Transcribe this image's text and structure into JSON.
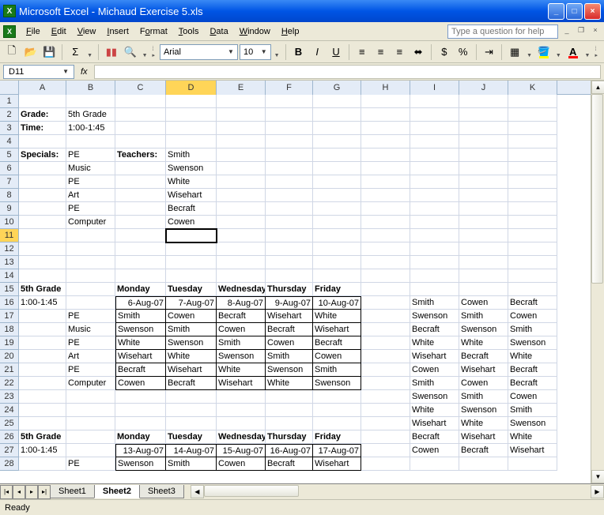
{
  "titlebar": {
    "app": "Microsoft Excel",
    "doc": "Michaud Exercise 5.xls"
  },
  "menu": {
    "file": "File",
    "edit": "Edit",
    "view": "View",
    "insert": "Insert",
    "format": "Format",
    "tools": "Tools",
    "data": "Data",
    "window": "Window",
    "help": "Help",
    "helpbox": "Type a question for help"
  },
  "toolbar": {
    "font": "Arial",
    "size": "10"
  },
  "namebox": {
    "ref": "D11",
    "fx": "fx"
  },
  "columns": [
    "A",
    "B",
    "C",
    "D",
    "E",
    "F",
    "G",
    "H",
    "I",
    "J",
    "K"
  ],
  "rows": [
    "1",
    "2",
    "3",
    "4",
    "5",
    "6",
    "7",
    "8",
    "9",
    "10",
    "11",
    "12",
    "13",
    "14",
    "15",
    "16",
    "17",
    "18",
    "19",
    "20",
    "21",
    "22",
    "23",
    "24",
    "25",
    "26",
    "27",
    "28"
  ],
  "cells": {
    "r2": {
      "A": "Grade:",
      "B": "5th Grade"
    },
    "r3": {
      "A": "Time:",
      "B": "1:00-1:45"
    },
    "r5": {
      "A": "Specials:",
      "B": "PE",
      "C": "Teachers:",
      "D": "Smith"
    },
    "r6": {
      "B": "Music",
      "D": "Swenson"
    },
    "r7": {
      "B": "PE",
      "D": "White"
    },
    "r8": {
      "B": "Art",
      "D": "Wisehart"
    },
    "r9": {
      "B": "PE",
      "D": "Becraft"
    },
    "r10": {
      "B": "Computer",
      "D": "Cowen"
    },
    "r15": {
      "A": "5th Grade",
      "C": "Monday",
      "D": "Tuesday",
      "E": "Wednesday",
      "F": "Thursday",
      "G": "Friday"
    },
    "r16": {
      "A": "1:00-1:45",
      "C": "6-Aug-07",
      "D": "7-Aug-07",
      "E": "8-Aug-07",
      "F": "9-Aug-07",
      "G": "10-Aug-07",
      "I": "Smith",
      "J": "Cowen",
      "K": "Becraft"
    },
    "r17": {
      "B": "PE",
      "C": "Smith",
      "D": "Cowen",
      "E": "Becraft",
      "F": "Wisehart",
      "G": "White",
      "I": "Swenson",
      "J": "Smith",
      "K": "Cowen"
    },
    "r18": {
      "B": "Music",
      "C": "Swenson",
      "D": "Smith",
      "E": "Cowen",
      "F": "Becraft",
      "G": "Wisehart",
      "I": "Becraft",
      "J": "Swenson",
      "K": "Smith"
    },
    "r19": {
      "B": "PE",
      "C": "White",
      "D": "Swenson",
      "E": "Smith",
      "F": "Cowen",
      "G": "Becraft",
      "I": "White",
      "J": "White",
      "K": "Swenson"
    },
    "r20": {
      "B": "Art",
      "C": "Wisehart",
      "D": "White",
      "E": "Swenson",
      "F": "Smith",
      "G": "Cowen",
      "I": "Wisehart",
      "J": "Becraft",
      "K": "White"
    },
    "r21": {
      "B": "PE",
      "C": "Becraft",
      "D": "Wisehart",
      "E": "White",
      "F": "Swenson",
      "G": "Smith",
      "I": "Cowen",
      "J": "Wisehart",
      "K": "Becraft"
    },
    "r22": {
      "B": "Computer",
      "C": "Cowen",
      "D": "Becraft",
      "E": "Wisehart",
      "F": "White",
      "G": "Swenson",
      "I": "Smith",
      "J": "Cowen",
      "K": "Becraft"
    },
    "r23": {
      "I": "Swenson",
      "J": "Smith",
      "K": "Cowen"
    },
    "r24": {
      "I": "White",
      "J": "Swenson",
      "K": "Smith"
    },
    "r25": {
      "I": "Wisehart",
      "J": "White",
      "K": "Swenson"
    },
    "r26": {
      "A": "5th Grade",
      "C": "Monday",
      "D": "Tuesday",
      "E": "Wednesday",
      "F": "Thursday",
      "G": "Friday",
      "I": "Becraft",
      "J": "Wisehart",
      "K": "White"
    },
    "r27": {
      "A": "1:00-1:45",
      "C": "13-Aug-07",
      "D": "14-Aug-07",
      "E": "15-Aug-07",
      "F": "16-Aug-07",
      "G": "17-Aug-07",
      "I": "Cowen",
      "J": "Becraft",
      "K": "Wisehart"
    },
    "r28": {
      "B": "PE",
      "C": "Swenson",
      "D": "Smith",
      "E": "Cowen",
      "F": "Becraft",
      "G": "Wisehart"
    }
  },
  "tabs": {
    "s1": "Sheet1",
    "s2": "Sheet2",
    "s3": "Sheet3"
  },
  "status": {
    "ready": "Ready"
  }
}
